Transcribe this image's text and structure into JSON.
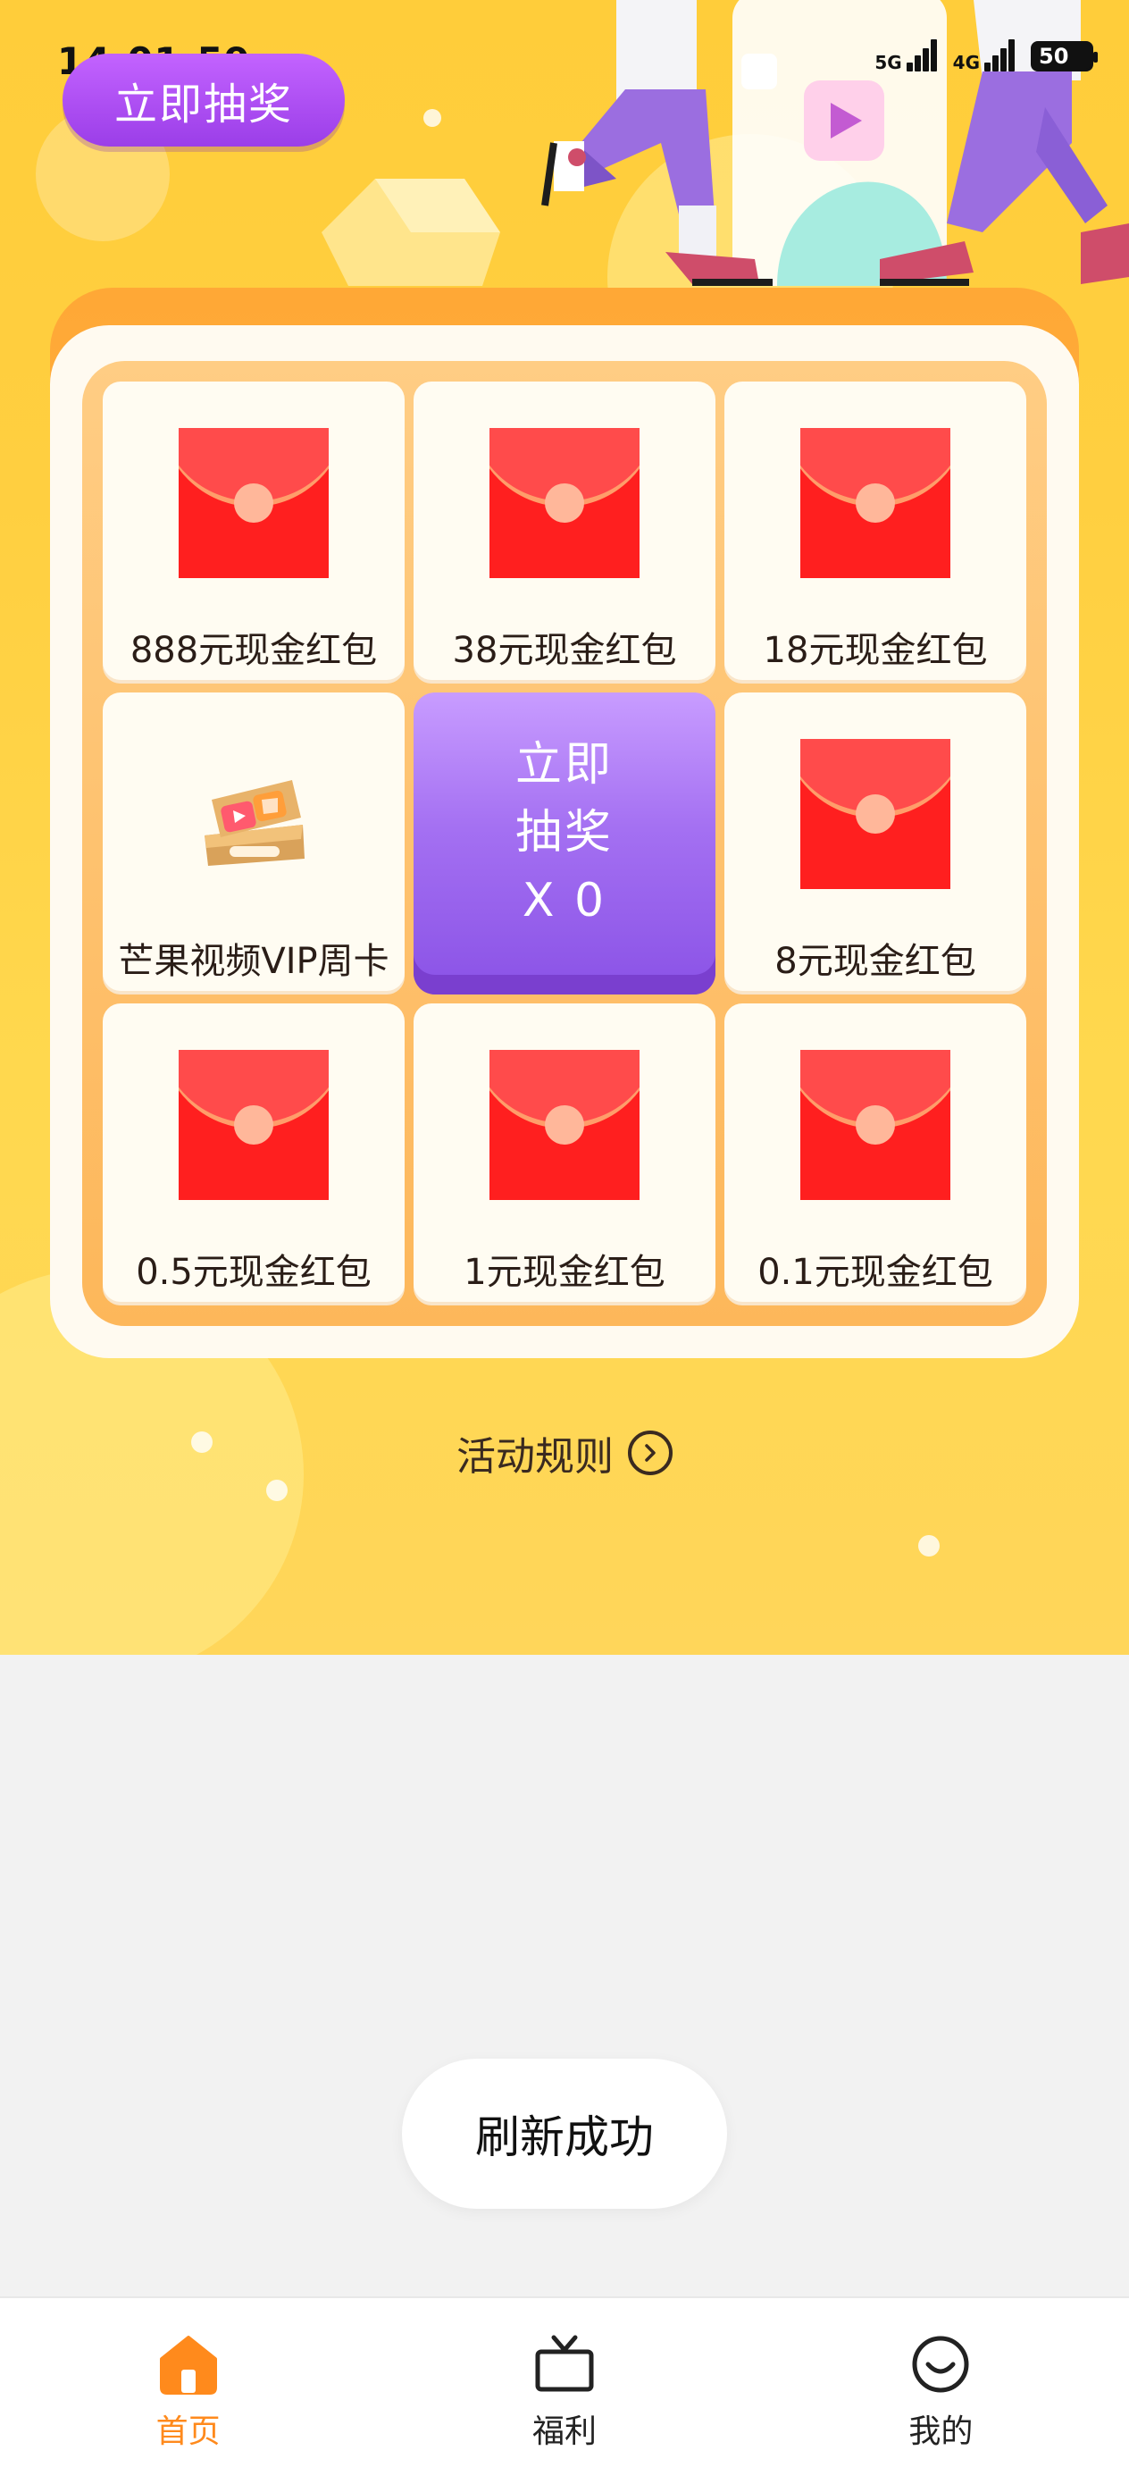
{
  "status_bar": {
    "time": "14:01:59",
    "network1": "5G",
    "network2": "4G",
    "battery": "50"
  },
  "top_button": {
    "label": "立即抽奖"
  },
  "prizes": [
    {
      "label": "888元现金红包",
      "icon": "red-envelope"
    },
    {
      "label": "38元现金红包",
      "icon": "red-envelope"
    },
    {
      "label": "18元现金红包",
      "icon": "red-envelope"
    },
    {
      "label": "芒果视频VIP周卡",
      "icon": "vip-ticket"
    },
    {
      "label": "8元现金红包",
      "icon": "red-envelope"
    },
    {
      "label": "0.5元现金红包",
      "icon": "red-envelope"
    },
    {
      "label": "1元现金红包",
      "icon": "red-envelope"
    },
    {
      "label": "0.1元现金红包",
      "icon": "red-envelope"
    }
  ],
  "center_button": {
    "line1": "立即",
    "line2": "抽奖",
    "line3": "X 0"
  },
  "rules": {
    "label": "活动规则"
  },
  "toast": {
    "text": "刷新成功"
  },
  "nav": [
    {
      "label": "首页",
      "icon": "home-icon",
      "active": true
    },
    {
      "label": "福利",
      "icon": "tv-icon",
      "active": false
    },
    {
      "label": "我的",
      "icon": "smile-icon",
      "active": false
    }
  ],
  "colors": {
    "accent": "#ff8a1c",
    "purple": "#a470f2",
    "hero_yellow": "#ffcd3a",
    "envelope_red": "#ff1f1f"
  }
}
